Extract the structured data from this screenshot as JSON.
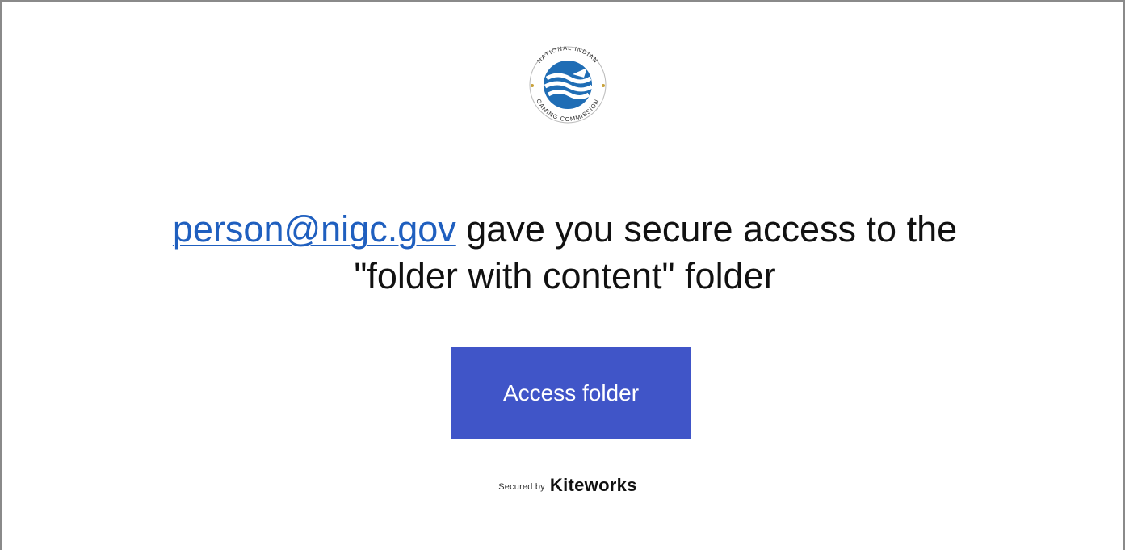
{
  "logo": {
    "seal_text_top": "NATIONAL INDIAN",
    "seal_text_bottom": "GAMING COMMISSION",
    "colors": {
      "blue": "#1f6db5",
      "gold": "#c8a23a"
    }
  },
  "message": {
    "sender_email": "person@nigc.gov",
    "text_line1": " gave you secure access to the",
    "text_line2": "\"folder with content\" folder"
  },
  "action": {
    "button_label": "Access folder",
    "button_color": "#4055c8"
  },
  "footer": {
    "secured_by": "Secured by",
    "brand": "Kiteworks"
  }
}
